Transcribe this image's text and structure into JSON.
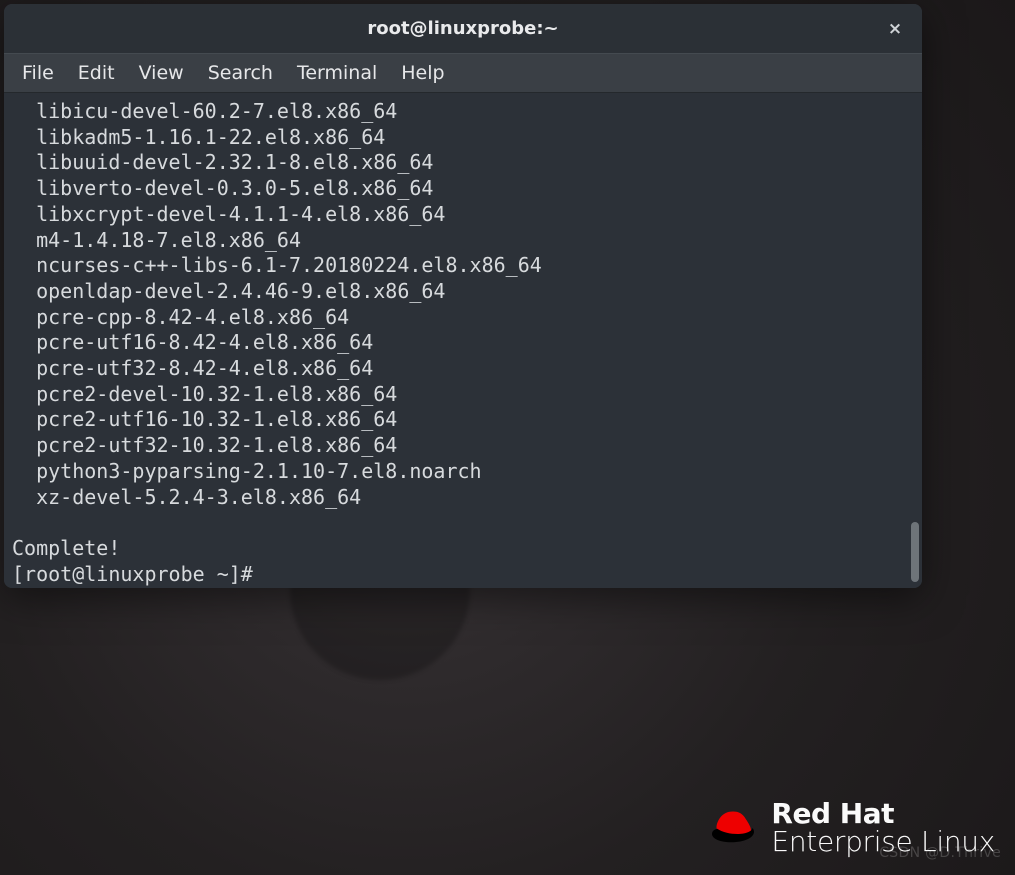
{
  "window": {
    "title": "root@linuxprobe:~",
    "close_glyph": "×"
  },
  "menu": {
    "file": "File",
    "edit": "Edit",
    "view": "View",
    "search": "Search",
    "terminal": "Terminal",
    "help": "Help"
  },
  "terminal": {
    "lines": [
      "  libicu-devel-60.2-7.el8.x86_64",
      "  libkadm5-1.16.1-22.el8.x86_64",
      "  libuuid-devel-2.32.1-8.el8.x86_64",
      "  libverto-devel-0.3.0-5.el8.x86_64",
      "  libxcrypt-devel-4.1.1-4.el8.x86_64",
      "  m4-1.4.18-7.el8.x86_64",
      "  ncurses-c++-libs-6.1-7.20180224.el8.x86_64",
      "  openldap-devel-2.4.46-9.el8.x86_64",
      "  pcre-cpp-8.42-4.el8.x86_64",
      "  pcre-utf16-8.42-4.el8.x86_64",
      "  pcre-utf32-8.42-4.el8.x86_64",
      "  pcre2-devel-10.32-1.el8.x86_64",
      "  pcre2-utf16-10.32-1.el8.x86_64",
      "  pcre2-utf32-10.32-1.el8.x86_64",
      "  python3-pyparsing-2.1.10-7.el8.noarch",
      "  xz-devel-5.2.4-3.el8.x86_64",
      "",
      "Complete!",
      "[root@linuxprobe ~]# "
    ]
  },
  "branding": {
    "line1": "Red Hat",
    "line2": "Enterprise Linux"
  },
  "watermark": "CSDN @D.Thrive"
}
